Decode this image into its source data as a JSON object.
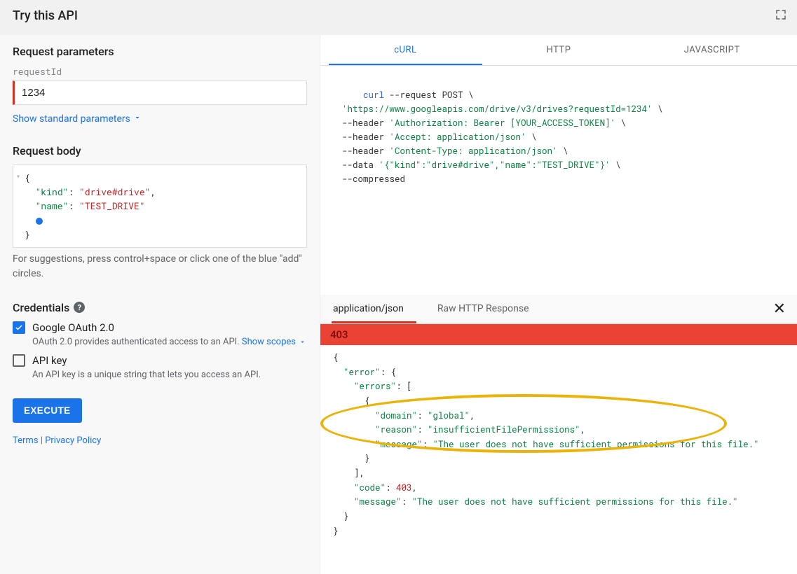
{
  "header": {
    "title": "Try this API"
  },
  "left": {
    "params_heading": "Request parameters",
    "requestId_label": "requestId",
    "requestId_value": "1234",
    "show_standard": "Show standard parameters",
    "body_heading": "Request body",
    "body_json": {
      "kind_key": "\"kind\"",
      "kind_val": "\"drive#drive\"",
      "name_key": "\"name\"",
      "name_val": "\"TEST_DRIVE\""
    },
    "body_hint": "For suggestions, press control+space or click one of the blue \"add\" circles.",
    "credentials_heading": "Credentials",
    "oauth": {
      "label": "Google OAuth 2.0",
      "desc": "OAuth 2.0 provides authenticated access to an API.",
      "show_scopes": "Show scopes"
    },
    "apikey": {
      "label": "API key",
      "desc": "An API key is a unique string that lets you access an API."
    },
    "execute": "EXECUTE",
    "footer": {
      "terms": "Terms",
      "sep": "|",
      "privacy": "Privacy Policy"
    }
  },
  "code": {
    "tabs": [
      "cURL",
      "HTTP",
      "JAVASCRIPT"
    ],
    "active_tab": 0,
    "lines": {
      "l1_cmd": "curl",
      "l1_flag": " --request ",
      "l1_method": "POST",
      "l1_bs": " \\",
      "l2": "  'https://www.googleapis.com/drive/v3/drives?requestId=1234'",
      "l3_flag": "  --header ",
      "l3_str": "'Authorization: Bearer [YOUR_ACCESS_TOKEN]'",
      "l4_flag": "  --header ",
      "l4_str": "'Accept: application/json'",
      "l5_flag": "  --header ",
      "l5_str": "'Content-Type: application/json'",
      "l6_flag": "  --data ",
      "l6_str": "'{\"kind\":\"drive#drive\",\"name\":\"TEST_DRIVE\"}'",
      "l7_flag": "  --compressed"
    }
  },
  "response": {
    "tabs": [
      "application/json",
      "Raw HTTP Response"
    ],
    "active_tab": 0,
    "status": "403",
    "json": {
      "k_error": "\"error\"",
      "k_errors": "\"errors\"",
      "k_domain": "\"domain\"",
      "v_domain": "\"global\"",
      "k_reason": "\"reason\"",
      "v_reason": "\"insufficientFilePermissions\"",
      "k_message": "\"message\"",
      "v_message": "\"The user does not have sufficient permissions for this file.\"",
      "k_code": "\"code\"",
      "v_code": "403"
    }
  }
}
